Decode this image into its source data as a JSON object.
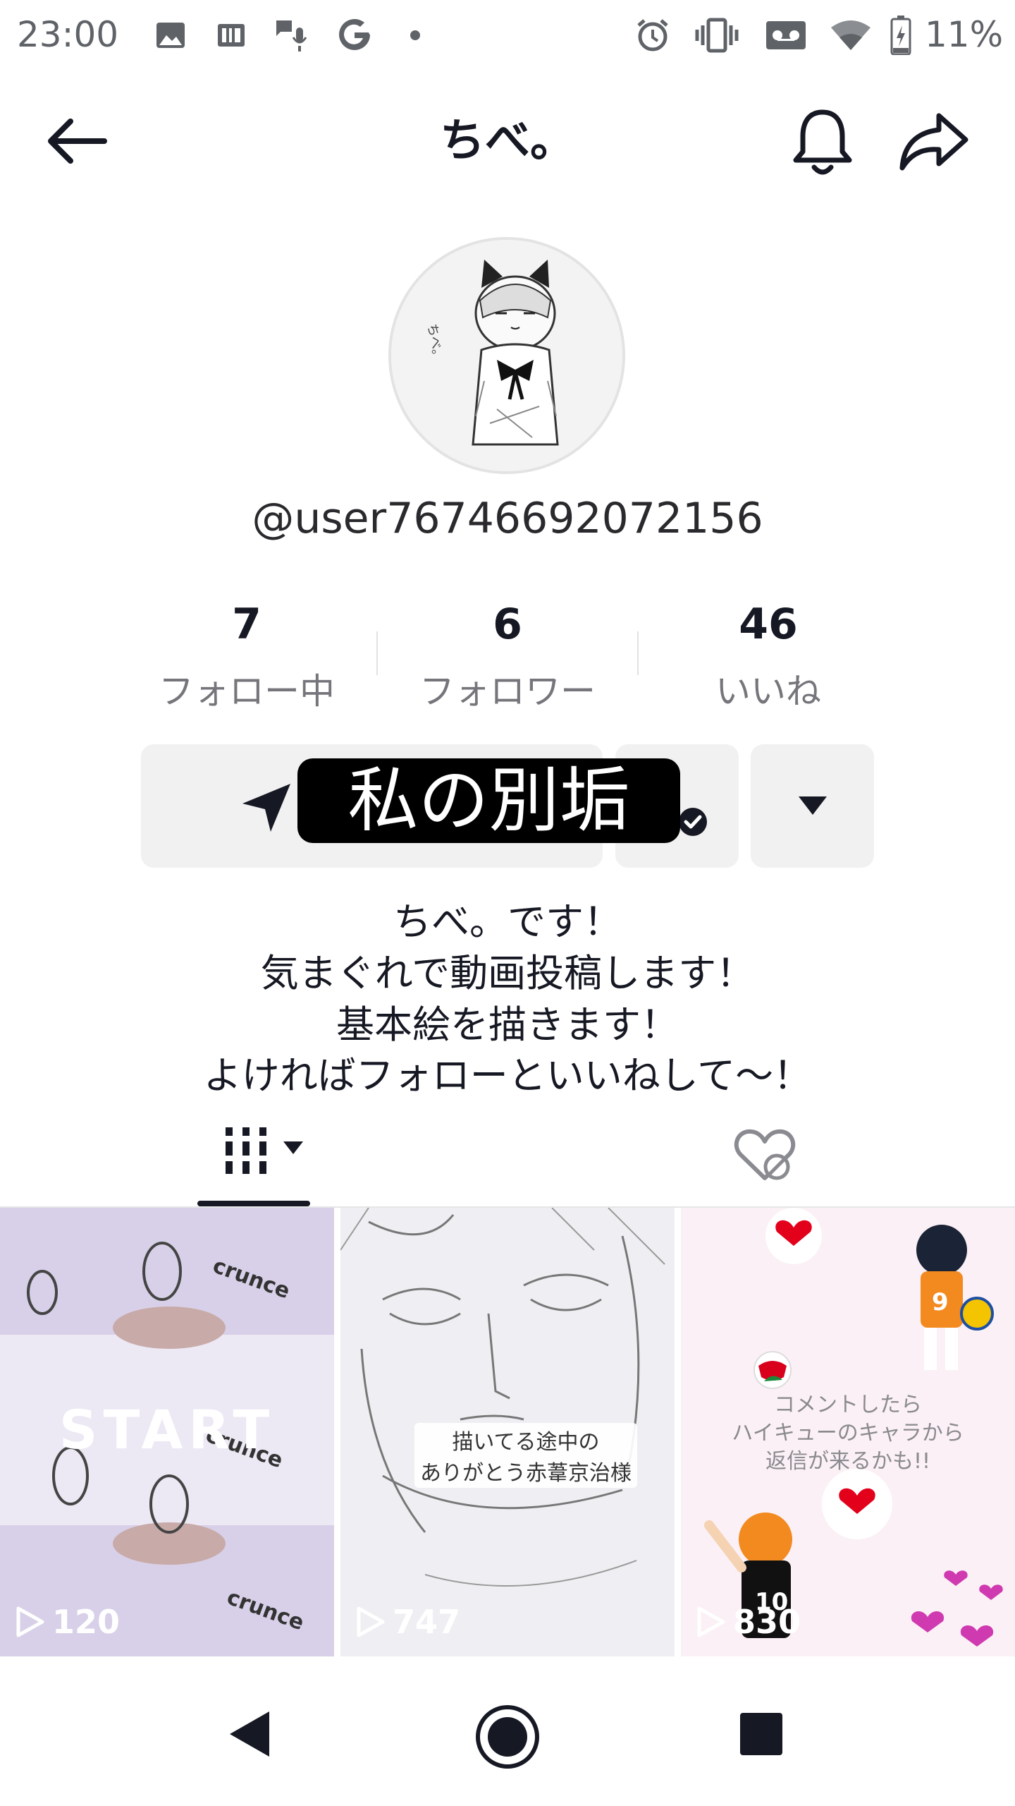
{
  "status_bar": {
    "time": "23:00",
    "battery": "11%",
    "icons": [
      "image-icon",
      "news-icon",
      "voice-chat-icon",
      "google-icon",
      "dot-icon",
      "alarm-icon",
      "vibrate-icon",
      "voicemail-icon",
      "wifi-icon",
      "battery-icon"
    ]
  },
  "header": {
    "title": "ちべ。"
  },
  "profile": {
    "username": "@user76746692072156",
    "stats": [
      {
        "value": "7",
        "label": "フォロー中"
      },
      {
        "value": "6",
        "label": "フォロワー"
      },
      {
        "value": "46",
        "label": "いいね"
      }
    ],
    "sticker_text": "私の別垢",
    "bio_lines": [
      "ちべ。です！",
      "気まぐれで動画投稿します！",
      "基本絵を描きます！",
      "よければフォローといいねして〜！"
    ]
  },
  "videos": [
    {
      "overlay": "START",
      "views": "120"
    },
    {
      "caption_line1": "描いてる途中の",
      "caption_line2": "ありがとう赤葦京治様",
      "views": "747"
    },
    {
      "caption_line1": "コメントしたら",
      "caption_line2": "ハイキューのキャラから",
      "caption_line3": "返信が来るかも!!",
      "views": "830"
    }
  ],
  "colors": {
    "text": "#161823",
    "muted": "#75757b",
    "button_bg": "#f1f1f2",
    "heart": "#e3001b"
  }
}
